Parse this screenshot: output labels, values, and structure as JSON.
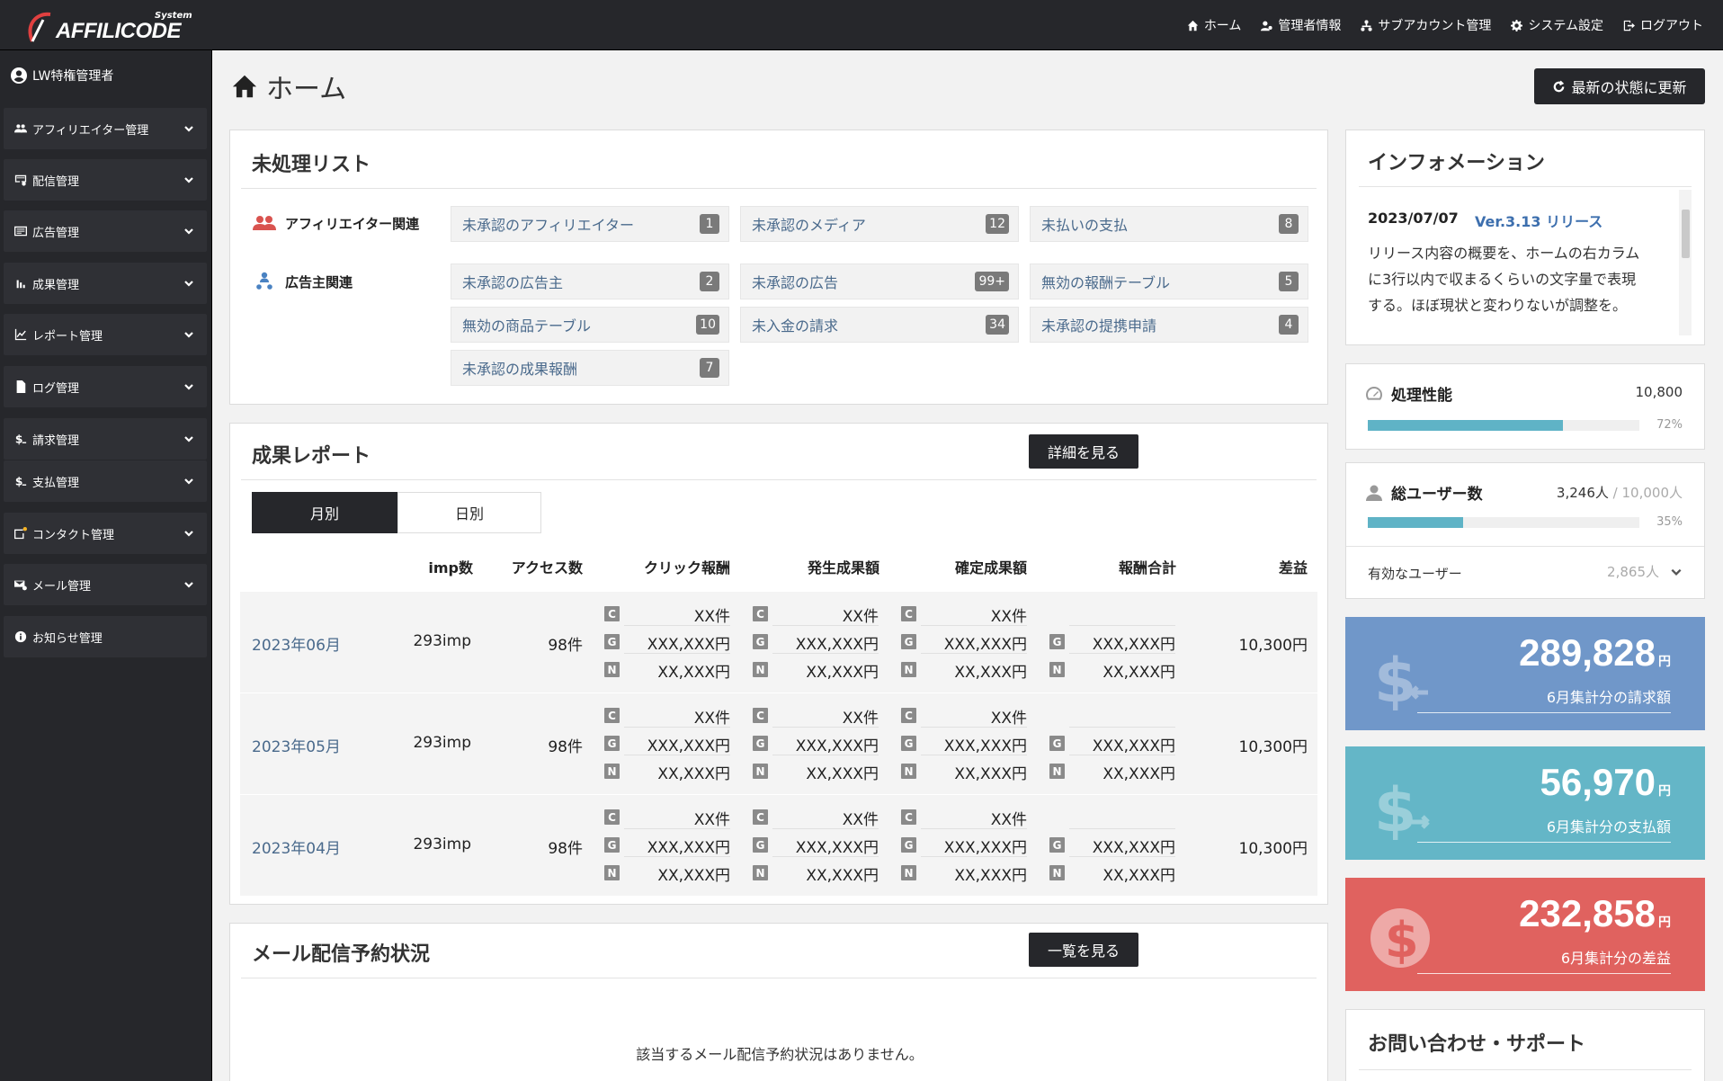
{
  "app": {
    "logo_top": "System",
    "logo_main": "AFFILICODE"
  },
  "topnav": [
    {
      "label": "ホーム",
      "icon": "home-icon"
    },
    {
      "label": "管理者情報",
      "icon": "user-cog-icon"
    },
    {
      "label": "サブアカウント管理",
      "icon": "sitemap-icon"
    },
    {
      "label": "システム設定",
      "icon": "gear-icon"
    },
    {
      "label": "ログアウト",
      "icon": "logout-icon"
    }
  ],
  "sidebar": {
    "user": "LW特権管理者",
    "items": [
      {
        "label": "アフィリエイター管理",
        "icon": "users-icon"
      },
      {
        "label": "配信管理",
        "icon": "mail-settings-icon"
      },
      {
        "label": "広告管理",
        "icon": "ad-icon"
      },
      {
        "label": "成果管理",
        "icon": "bar-chart-icon"
      },
      {
        "label": "レポート管理",
        "icon": "line-chart-icon"
      },
      {
        "label": "ログ管理",
        "icon": "file-icon"
      },
      {
        "label": "請求管理",
        "icon": "dollar-in-icon"
      },
      {
        "label": "支払管理",
        "icon": "dollar-out-icon"
      },
      {
        "label": "コンタクト管理",
        "icon": "contact-icon"
      },
      {
        "label": "メール管理",
        "icon": "mail-icon"
      },
      {
        "label": "お知らせ管理",
        "icon": "info-icon"
      }
    ]
  },
  "page": {
    "title": "ホーム",
    "refresh": "最新の状態に更新"
  },
  "pending": {
    "title": "未処理リスト",
    "group_affiliate": "アフィリエイター関連",
    "group_advertiser": "広告主関連",
    "affiliate": [
      {
        "label": "未承認のアフィリエイター",
        "count": "1"
      },
      {
        "label": "未承認のメディア",
        "count": "12"
      },
      {
        "label": "未払いの支払",
        "count": "8"
      }
    ],
    "advertiser": [
      {
        "label": "未承認の広告主",
        "count": "2"
      },
      {
        "label": "未承認の広告",
        "count": "99+"
      },
      {
        "label": "無効の報酬テーブル",
        "count": "5"
      },
      {
        "label": "無効の商品テーブル",
        "count": "10"
      },
      {
        "label": "未入金の請求",
        "count": "34"
      },
      {
        "label": "未承認の提携申請",
        "count": "4"
      },
      {
        "label": "未承認の成果報酬",
        "count": "7"
      }
    ]
  },
  "report": {
    "title": "成果レポート",
    "detail_button": "詳細を見る",
    "tabs": [
      "月別",
      "日別"
    ],
    "headers": [
      "imp数",
      "アクセス数",
      "クリック報酬",
      "発生成果額",
      "確定成果額",
      "報酬合計",
      "差益"
    ],
    "tags": [
      "C",
      "G",
      "N"
    ],
    "rows": [
      {
        "month": "2023年06月",
        "imp": "293imp",
        "access": "98件",
        "count": "XX件",
        "g_amount": "XXX,XXX円",
        "n_amount": "XX,XXX円",
        "profit": "10,300円"
      },
      {
        "month": "2023年05月",
        "imp": "293imp",
        "access": "98件",
        "count": "XX件",
        "g_amount": "XXX,XXX円",
        "n_amount": "XX,XXX円",
        "profit": "10,300円"
      },
      {
        "month": "2023年04月",
        "imp": "293imp",
        "access": "98件",
        "count": "XX件",
        "g_amount": "XXX,XXX円",
        "n_amount": "XX,XXX円",
        "profit": "10,300円"
      }
    ]
  },
  "mail": {
    "title": "メール配信予約状況",
    "list_button": "一覧を見る",
    "empty": "該当するメール配信予約状況はありません。"
  },
  "info": {
    "title": "インフォメーション",
    "date": "2023/07/07",
    "version": "Ver.3.13 リリース",
    "lines": [
      "リリース内容の概要を、ホームの右カラム",
      "に3行以内で収まるくらいの文字量で表現",
      "する。ほぼ現状と変わりないが調整を。"
    ]
  },
  "performance": {
    "title": "処理性能",
    "value": "10,800",
    "percent_label": "72%",
    "percent": 72
  },
  "users": {
    "title": "総ユーザー数",
    "value": "3,246人",
    "separator": "/",
    "limit": "10,000人",
    "percent_label": "35%",
    "percent": 35,
    "active_label": "有効なユーザー",
    "active_value": "2,865人"
  },
  "summary": [
    {
      "value": "289,828",
      "unit": "円",
      "label": "6月集計分の請求額",
      "color": "#7097c9",
      "icon": "dollar-in-icon"
    },
    {
      "value": "56,970",
      "unit": "円",
      "label": "6月集計分の支払額",
      "color": "#64b6c7",
      "icon": "dollar-out-icon"
    },
    {
      "value": "232,858",
      "unit": "円",
      "label": "6月集計分の差益",
      "color": "#e0625f",
      "icon": "dollar-circle-icon"
    }
  ],
  "support": {
    "title": "お問い合わせ・サポート"
  }
}
